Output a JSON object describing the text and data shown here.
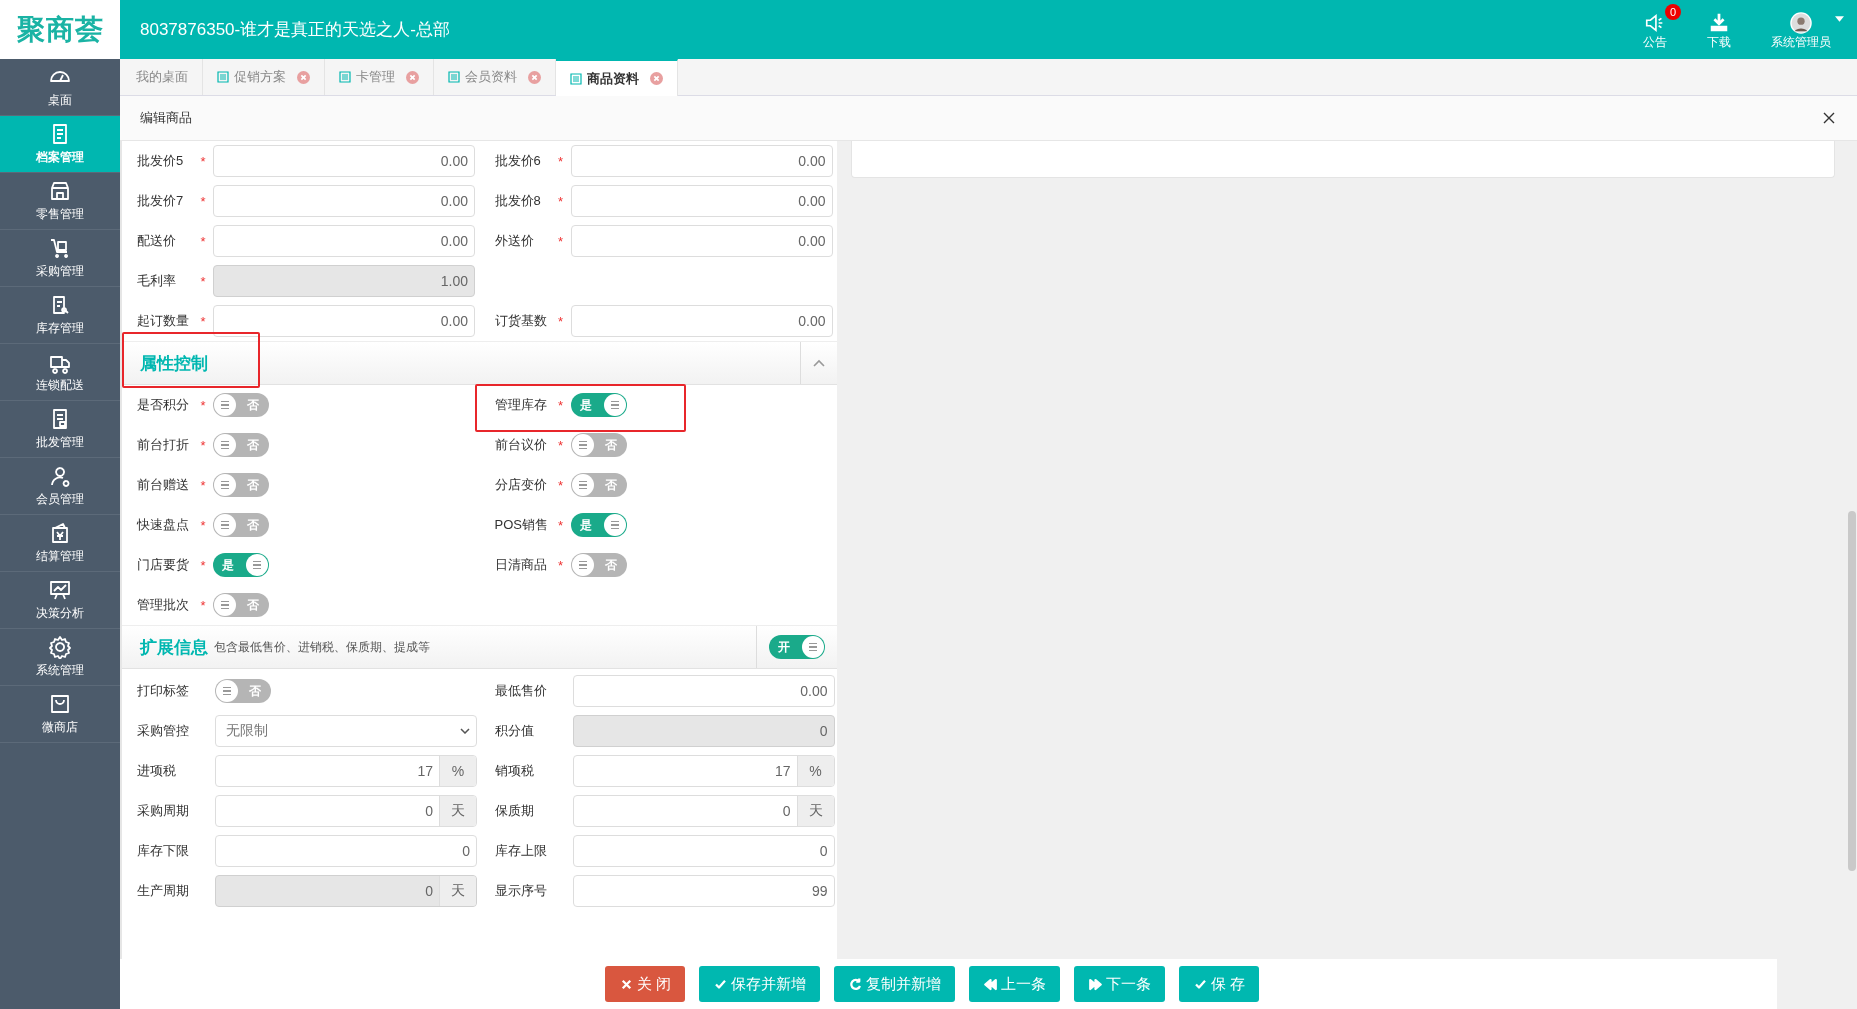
{
  "header": {
    "logo": "聚商荟",
    "title": "8037876350-谁才是真正的天选之人-总部",
    "actions": [
      {
        "kind": "notice",
        "label": "公告",
        "badge": "0"
      },
      {
        "kind": "download",
        "label": "下载"
      },
      {
        "kind": "user",
        "label": "系统管理员"
      }
    ]
  },
  "sidebar": {
    "items": [
      {
        "label": "桌面",
        "selected": false
      },
      {
        "label": "档案管理",
        "selected": true
      },
      {
        "label": "零售管理",
        "selected": false
      },
      {
        "label": "采购管理",
        "selected": false
      },
      {
        "label": "库存管理",
        "selected": false
      },
      {
        "label": "连锁配送",
        "selected": false
      },
      {
        "label": "批发管理",
        "selected": false
      },
      {
        "label": "会员管理",
        "selected": false
      },
      {
        "label": "结算管理",
        "selected": false
      },
      {
        "label": "决策分析",
        "selected": false
      },
      {
        "label": "系统管理",
        "selected": false
      },
      {
        "label": "微商店",
        "selected": false
      }
    ]
  },
  "tabs": [
    {
      "label": "我的桌面",
      "selected": false,
      "closable": false
    },
    {
      "label": "促销方案",
      "selected": false,
      "closable": true
    },
    {
      "label": "卡管理",
      "selected": false,
      "closable": true
    },
    {
      "label": "会员资料",
      "selected": false,
      "closable": true
    },
    {
      "label": "商品资料",
      "selected": true,
      "closable": true
    }
  ],
  "panel": {
    "title": "编辑商品"
  },
  "price_rows": [
    {
      "left": {
        "label": "批发价5",
        "required_mark": "*",
        "value": "0.00",
        "disabled": false
      },
      "right": {
        "label": "批发价6",
        "required_mark": "*",
        "value": "0.00",
        "disabled": false
      }
    },
    {
      "left": {
        "label": "批发价7",
        "required_mark": "*",
        "value": "0.00",
        "disabled": false
      },
      "right": {
        "label": "批发价8",
        "required_mark": "*",
        "value": "0.00",
        "disabled": false
      }
    },
    {
      "left": {
        "label": "配送价",
        "required_mark": "*",
        "value": "0.00",
        "disabled": false
      },
      "right": {
        "label": "外送价",
        "required_mark": "*",
        "value": "0.00",
        "disabled": false
      }
    },
    {
      "left": {
        "label": "毛利率",
        "required_mark": "*",
        "value": "1.00",
        "disabled": true
      }
    },
    {
      "left": {
        "label": "起订数量",
        "required_mark": "*",
        "value": "0.00",
        "disabled": false
      },
      "right": {
        "label": "订货基数",
        "required_mark": "*",
        "value": "0.00",
        "disabled": false
      }
    }
  ],
  "attributes": {
    "title": "属性控制",
    "highlighted": true,
    "expanded": true,
    "toggles": [
      {
        "label": "是否积分",
        "required_mark": "*",
        "on": false,
        "text": "否",
        "highlighted": false
      },
      {
        "label": "管理库存",
        "required_mark": "*",
        "on": true,
        "text": "是",
        "highlighted": true
      },
      {
        "label": "前台打折",
        "required_mark": "*",
        "on": false,
        "text": "否",
        "highlighted": false
      },
      {
        "label": "前台议价",
        "required_mark": "*",
        "on": false,
        "text": "否",
        "highlighted": false
      },
      {
        "label": "前台赠送",
        "required_mark": "*",
        "on": false,
        "text": "否",
        "highlighted": false
      },
      {
        "label": "分店变价",
        "required_mark": "*",
        "on": false,
        "text": "否",
        "highlighted": false
      },
      {
        "label": "快速盘点",
        "required_mark": "*",
        "on": false,
        "text": "否",
        "highlighted": false
      },
      {
        "label": "POS销售",
        "required_mark": "*",
        "on": true,
        "text": "是",
        "highlighted": false
      },
      {
        "label": "门店要货",
        "required_mark": "*",
        "on": true,
        "text": "是",
        "highlighted": false
      },
      {
        "label": "日清商品",
        "required_mark": "*",
        "on": false,
        "text": "否",
        "highlighted": false
      },
      {
        "label": "管理批次",
        "required_mark": "*",
        "on": false,
        "text": "否",
        "highlighted": false
      }
    ]
  },
  "extension": {
    "title": "扩展信息",
    "description": "包含最低售价、进销税、保质期、提成等",
    "toggle": {
      "on": true,
      "text": "开"
    },
    "fields": [
      {
        "kind": "toggle",
        "label": "打印标签",
        "on": false,
        "text": "否"
      },
      {
        "kind": "input",
        "label": "最低售价",
        "value": "0.00",
        "disabled": false
      },
      {
        "kind": "select",
        "label": "采购管控",
        "value": "无限制"
      },
      {
        "kind": "input",
        "label": "积分值",
        "value": "0",
        "disabled": true
      },
      {
        "kind": "unit",
        "label": "进项税",
        "value": "17",
        "unit": "%",
        "disabled": false
      },
      {
        "kind": "unit",
        "label": "销项税",
        "value": "17",
        "unit": "%",
        "disabled": false
      },
      {
        "kind": "unit",
        "label": "采购周期",
        "value": "0",
        "unit": "天",
        "disabled": false
      },
      {
        "kind": "unit",
        "label": "保质期",
        "value": "0",
        "unit": "天",
        "disabled": false
      },
      {
        "kind": "input",
        "label": "库存下限",
        "value": "0",
        "disabled": false
      },
      {
        "kind": "input",
        "label": "库存上限",
        "value": "0",
        "disabled": false
      },
      {
        "kind": "unit",
        "label": "生产周期",
        "value": "0",
        "unit": "天",
        "disabled": true
      },
      {
        "kind": "input",
        "label": "显示序号",
        "value": "99",
        "disabled": false
      }
    ]
  },
  "footer_buttons": [
    {
      "kind": "close",
      "label": "关 闭"
    },
    {
      "kind": "save_new",
      "label": "保存并新增"
    },
    {
      "kind": "copy_new",
      "label": "复制并新增"
    },
    {
      "kind": "prev",
      "label": "上一条"
    },
    {
      "kind": "next",
      "label": "下一条"
    },
    {
      "kind": "save",
      "label": "保 存"
    }
  ]
}
